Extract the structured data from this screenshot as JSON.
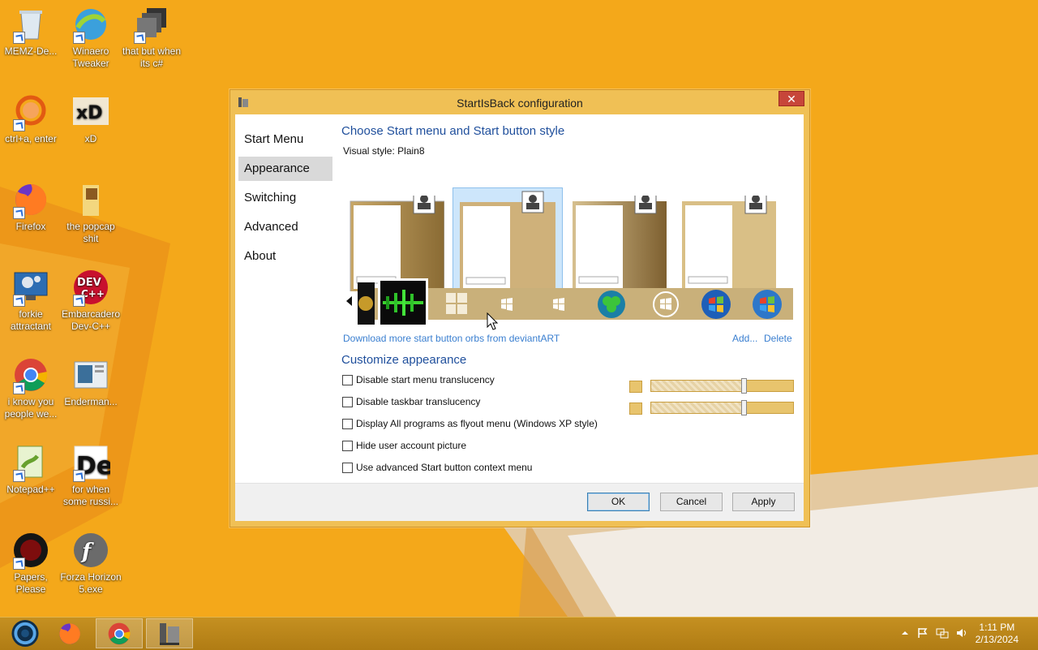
{
  "desktop": {
    "icons": [
      {
        "label": "MEMZ-De...",
        "icon": "recycle-bin-icon"
      },
      {
        "label": "Winaero Tweaker",
        "icon": "winaero-icon"
      },
      {
        "label": "that but when its c#",
        "icon": "stack-icon"
      },
      {
        "label": "ctrl+a, enter",
        "icon": "orange-ring-icon"
      },
      {
        "label": "xD",
        "icon": "xd-icon"
      },
      {
        "label": "Firefox",
        "icon": "firefox-icon"
      },
      {
        "label": "the popcap shit",
        "icon": "folder-icon"
      },
      {
        "label": "forkie attractant",
        "icon": "gear-monitor-icon"
      },
      {
        "label": "Embarcadero Dev-C++",
        "icon": "devcpp-icon"
      },
      {
        "label": "i know you people we...",
        "icon": "chrome-icon"
      },
      {
        "label": "Enderman...",
        "icon": "image-file-icon"
      },
      {
        "label": "Notepad++",
        "icon": "notepadpp-icon"
      },
      {
        "label": "for when some russi...",
        "icon": "de-icon"
      },
      {
        "label": "Papers, Please",
        "icon": "papers-please-icon"
      },
      {
        "label": "Forza Horizon 5.exe",
        "icon": "flash-icon"
      }
    ]
  },
  "dialog": {
    "title": "StartIsBack configuration",
    "close_label": "✕",
    "nav": [
      "Start Menu",
      "Appearance",
      "Switching",
      "Advanced",
      "About"
    ],
    "active_nav": "Appearance",
    "heading": "Choose Start menu and Start button style",
    "visual_style_label": "Visual style:",
    "visual_style_value": "Plain8",
    "download_link": "Download more start button orbs from deviantART",
    "add_link": "Add...",
    "delete_link": "Delete",
    "customize_heading": "Customize appearance",
    "options": [
      {
        "label": "Disable start menu translucency",
        "checked": false
      },
      {
        "label": "Disable taskbar translucency",
        "checked": false
      },
      {
        "label": "Display All programs as flyout menu (Windows XP style)",
        "checked": false
      },
      {
        "label": "Hide user account picture",
        "checked": false
      },
      {
        "label": "Use advanced Start button context menu",
        "checked": false
      }
    ],
    "buttons": {
      "ok": "OK",
      "cancel": "Cancel",
      "apply": "Apply"
    }
  },
  "taskbar": {
    "clock_time": "1:11 PM",
    "clock_date": "2/13/2024"
  },
  "colors": {
    "accent": "#f2a316",
    "dialog_frame": "#f0c055",
    "link": "#3a7fd0",
    "heading": "#1f4f9c"
  }
}
